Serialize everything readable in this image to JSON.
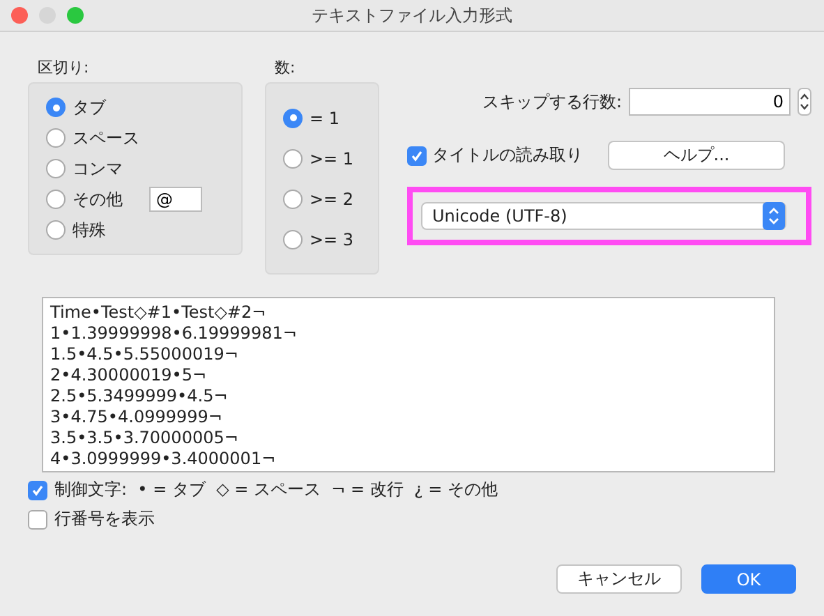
{
  "window": {
    "title": "テキストファイル入力形式"
  },
  "delimiter": {
    "label": "区切り:",
    "options": [
      {
        "label": "タブ",
        "selected": true
      },
      {
        "label": "スペース",
        "selected": false
      },
      {
        "label": "コンマ",
        "selected": false
      },
      {
        "label": "その他",
        "selected": false,
        "value": "@"
      },
      {
        "label": "特殊",
        "selected": false
      }
    ]
  },
  "count": {
    "label": "数:",
    "options": [
      {
        "label": "= 1",
        "selected": true
      },
      {
        "label": ">= 1",
        "selected": false
      },
      {
        "label": ">= 2",
        "selected": false
      },
      {
        "label": ">= 3",
        "selected": false
      }
    ]
  },
  "skip_lines": {
    "label": "スキップする行数:",
    "value": "0"
  },
  "read_titles": {
    "label": "タイトルの読み取り",
    "checked": true
  },
  "help_button": "ヘルプ...",
  "encoding": {
    "value": "Unicode (UTF-8)",
    "highlighted": true
  },
  "preview": [
    "Time•Test◇#1•Test◇#2¬",
    "1•1.39999998•6.19999981¬",
    "1.5•4.5•5.55000019¬",
    "2•4.30000019•5¬",
    "2.5•5.3499999•4.5¬",
    "3•4.75•4.0999999¬",
    "3.5•3.5•3.70000005¬",
    "4•3.0999999•3.4000001¬"
  ],
  "options": [
    {
      "label": "制御文字:  • = タブ  ◇ = スペース  ¬ = 改行  ¿ = その他",
      "checked": true
    },
    {
      "label": "行番号を表示",
      "checked": false
    }
  ],
  "buttons": [
    {
      "label": "キャンセル",
      "kind": "default"
    },
    {
      "label": "OK",
      "kind": "primary"
    }
  ]
}
